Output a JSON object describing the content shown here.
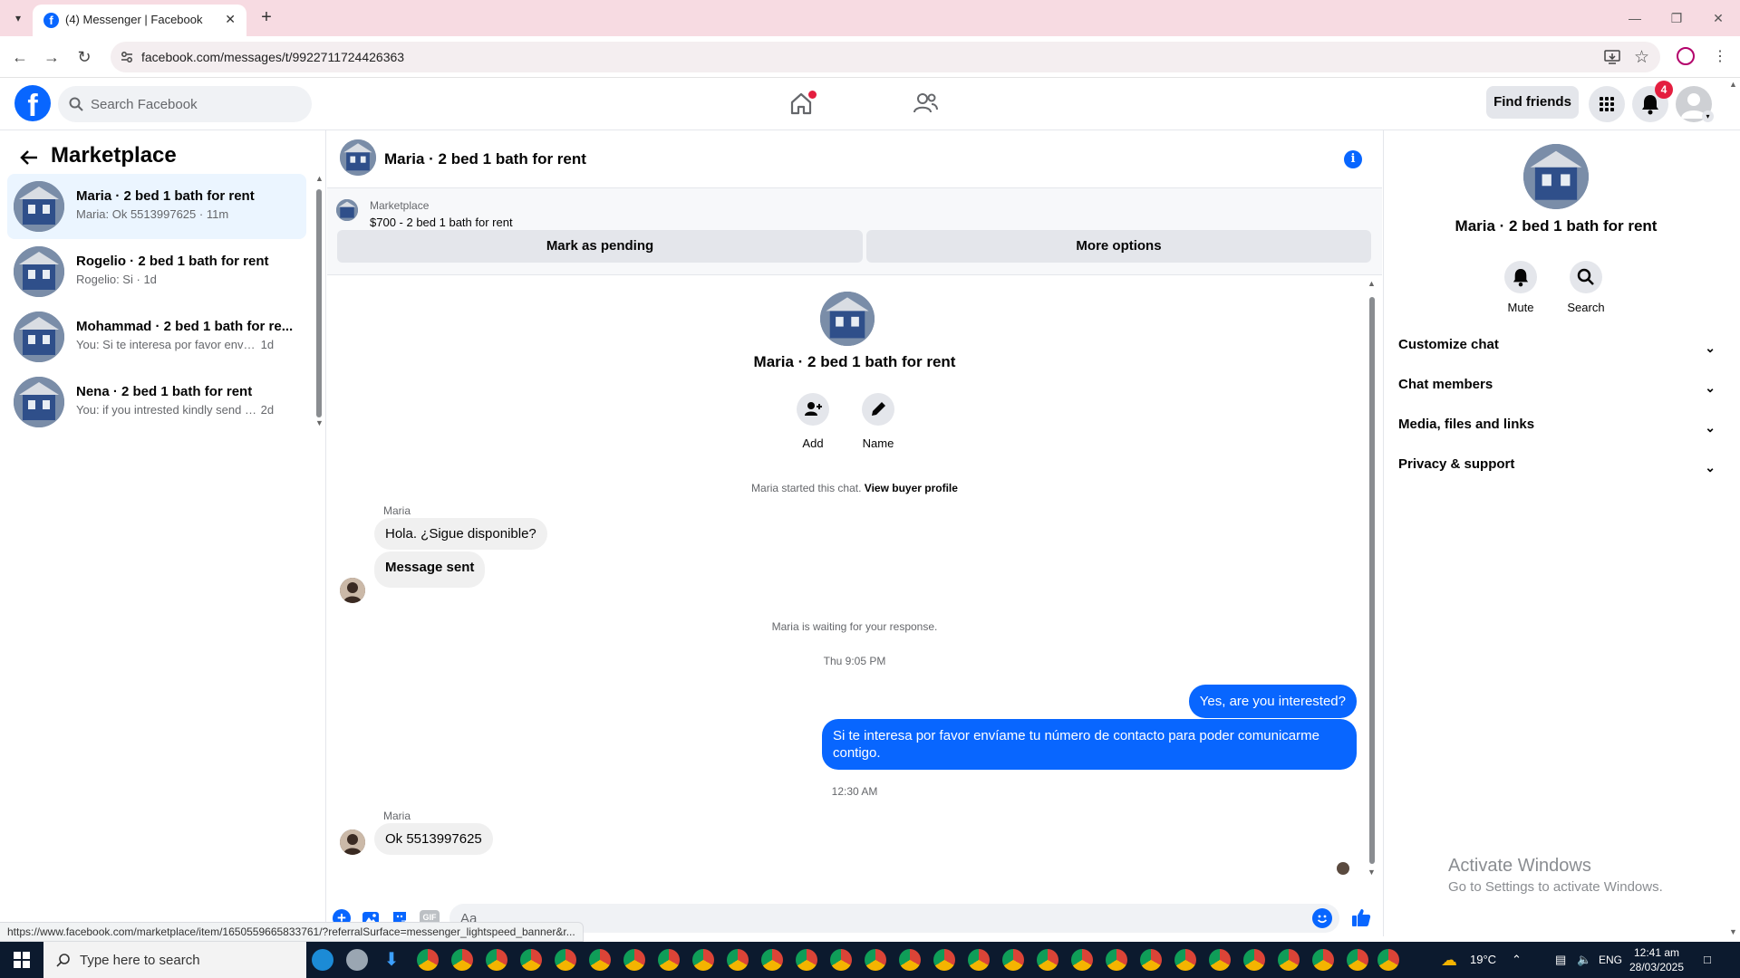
{
  "browser": {
    "tab_title": "(4) Messenger | Facebook",
    "favicon_letter": "f",
    "url": "facebook.com/messages/t/9922711724426363",
    "status_url": "https://www.facebook.com/marketplace/item/1650559665833761/?referralSurface=messenger_lightspeed_banner&r..."
  },
  "fb_header": {
    "logo_letter": "f",
    "search_placeholder": "Search Facebook",
    "find_friends": "Find friends",
    "notification_count": "4"
  },
  "left_panel": {
    "title": "Marketplace",
    "conversations": [
      {
        "name": "Maria · 2 bed 1 bath for rent",
        "preview": "Maria: Ok 5513997625",
        "time": "11m",
        "active": true
      },
      {
        "name": "Rogelio · 2 bed 1 bath for rent",
        "preview": "Rogelio: Si",
        "time": "1d",
        "active": false
      },
      {
        "name": "Mohammad · 2 bed 1 bath for re...",
        "preview": "You: Si te interesa por favor envíam...",
        "time": "1d",
        "active": false
      },
      {
        "name": "Nena · 2 bed 1 bath for rent",
        "preview": "You: if you intrested kindly send m...",
        "time": "2d",
        "active": false
      }
    ]
  },
  "chat": {
    "header_name": "Maria · 2 bed 1 bath for rent",
    "marketplace_label": "Marketplace",
    "listing": "$700 - 2 bed 1 bath for rent",
    "mark_pending": "Mark as pending",
    "more_options": "More options",
    "intro_name": "Maria · 2 bed 1 bath for rent",
    "add_label": "Add",
    "name_label": "Name",
    "started_text": "Maria started this chat.",
    "view_profile": "View buyer profile",
    "sender1": "Maria",
    "msg1": "Hola. ¿Sigue disponible?",
    "msg2": "Message sent",
    "waiting": "Maria is waiting for your response.",
    "time1": "Thu 9:05 PM",
    "out1": "Yes, are you interested?",
    "out2": "Si te interesa por favor envíame tu número de contacto para poder comunicarme contigo.",
    "time2": "12:30 AM",
    "sender2": "Maria",
    "msg3": "Ok 5513997625",
    "composer_placeholder": "Aa"
  },
  "right_panel": {
    "name": "Maria · 2 bed 1 bath for rent",
    "mute": "Mute",
    "search": "Search",
    "sections": [
      "Customize chat",
      "Chat members",
      "Media, files and links",
      "Privacy & support"
    ]
  },
  "watermark": {
    "line1": "Activate Windows",
    "line2": "Go to Settings to activate Windows."
  },
  "taskbar": {
    "search_placeholder": "Type here to search",
    "temperature": "19°C",
    "language": "ENG",
    "time": "12:41 am",
    "date": "28/03/2025"
  },
  "colors": {
    "accent": "#0866ff",
    "tabstrip": "#f7dbe2",
    "badge": "#e41e3f"
  }
}
